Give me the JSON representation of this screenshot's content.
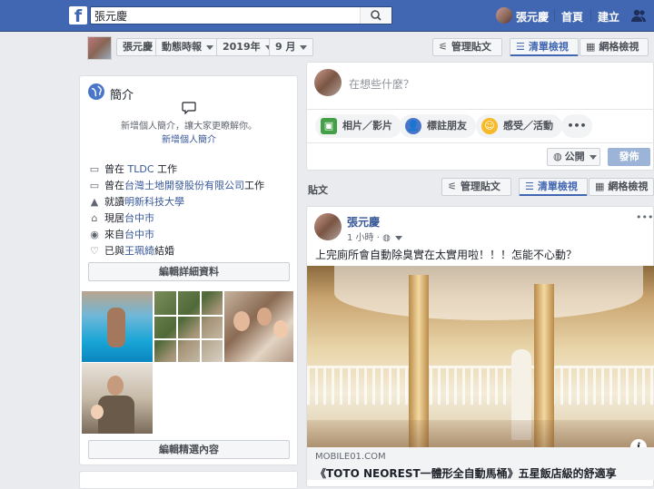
{
  "topbar": {
    "logo": "f",
    "search_value": "張元慶",
    "user_name": "張元慶",
    "home": "首頁",
    "create": "建立"
  },
  "subbar": {
    "name": "張元慶",
    "timeline": "動態時報",
    "year": "2019年",
    "month": "9 月",
    "manage_posts": "管理貼文",
    "list_view": "清單檢視",
    "grid_view": "網格檢視"
  },
  "intro": {
    "title": "簡介",
    "prompt": "新增個人簡介，讓大家更瞭解你。",
    "add_bio": "新增個人簡介",
    "rows": [
      {
        "prefix": "曾在 ",
        "link": "TLDC",
        "suffix": " 工作"
      },
      {
        "prefix": "曾在",
        "link": "台灣土地開發股份有限公司",
        "suffix": "工作"
      },
      {
        "prefix": "就讀",
        "link": "明新科技大學",
        "suffix": ""
      },
      {
        "prefix": "現居",
        "link": "台中市",
        "suffix": ""
      },
      {
        "prefix": "來自",
        "link": "台中市",
        "suffix": ""
      },
      {
        "prefix": "已與",
        "link": "王珮綺",
        "suffix": "結婚"
      }
    ],
    "edit_details": "編輯詳細資料",
    "edit_featured": "編輯精選內容"
  },
  "composer": {
    "placeholder": "在想些什麼？",
    "photo_video": "相片／影片",
    "tag_friends": "標註朋友",
    "feeling": "感受／活動",
    "more": "•••",
    "audience": "公開",
    "post_button": "發佈"
  },
  "posts_header": {
    "title": "貼文",
    "manage_posts": "管理貼文",
    "list_view": "清單檢視",
    "grid_view": "網格檢視"
  },
  "post": {
    "author": "張元慶",
    "time": "1 小時",
    "menu": "•••",
    "text": "上完廁所會自動除臭實在太實用啦！！！怎能不心動？",
    "link_domain": "MOBILE01.COM",
    "link_title": "《TOTO NEOREST一體形全自動馬桶》五星飯店級的舒適享",
    "info": "i"
  },
  "icons": [
    "facebook-logo",
    "search-icon",
    "friends-icon",
    "globe-icon",
    "speech-bubble-icon",
    "briefcase-icon",
    "graduation-cap-icon",
    "home-icon",
    "location-pin-icon",
    "heart-icon",
    "manage-posts-icon",
    "list-view-icon",
    "grid-view-icon",
    "photo-icon",
    "tag-friends-icon",
    "feeling-icon"
  ],
  "colors": {
    "brand": "#4267b2",
    "link": "#385898",
    "post_button": "#9cb4d8"
  }
}
